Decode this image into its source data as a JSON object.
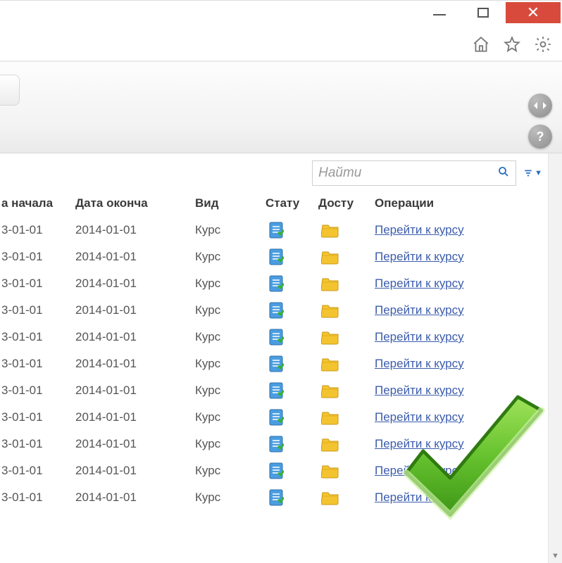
{
  "search": {
    "placeholder": "Найти"
  },
  "columns": {
    "start": "а начала",
    "end": "Дата оконча",
    "kind": "Вид",
    "status": "Стату",
    "access": "Досту",
    "ops": "Операции"
  },
  "rows": [
    {
      "start": "3-01-01",
      "end": "2014-01-01",
      "kind": "Курс",
      "op": "Перейти к курсу"
    },
    {
      "start": "3-01-01",
      "end": "2014-01-01",
      "kind": "Курс",
      "op": "Перейти к курсу"
    },
    {
      "start": "3-01-01",
      "end": "2014-01-01",
      "kind": "Курс",
      "op": "Перейти к курсу"
    },
    {
      "start": "3-01-01",
      "end": "2014-01-01",
      "kind": "Курс",
      "op": "Перейти к курсу"
    },
    {
      "start": "3-01-01",
      "end": "2014-01-01",
      "kind": "Курс",
      "op": "Перейти к курсу"
    },
    {
      "start": "3-01-01",
      "end": "2014-01-01",
      "kind": "Курс",
      "op": "Перейти к курсу"
    },
    {
      "start": "3-01-01",
      "end": "2014-01-01",
      "kind": "Курс",
      "op": "Перейти к курсу"
    },
    {
      "start": "3-01-01",
      "end": "2014-01-01",
      "kind": "Курс",
      "op": "Перейти к курсу"
    },
    {
      "start": "3-01-01",
      "end": "2014-01-01",
      "kind": "Курс",
      "op": "Перейти к курсу"
    },
    {
      "start": "3-01-01",
      "end": "2014-01-01",
      "kind": "Курс",
      "op": "Перейти к курсу"
    },
    {
      "start": "3-01-01",
      "end": "2014-01-01",
      "kind": "Курс",
      "op": "Перейти к курсу"
    }
  ]
}
